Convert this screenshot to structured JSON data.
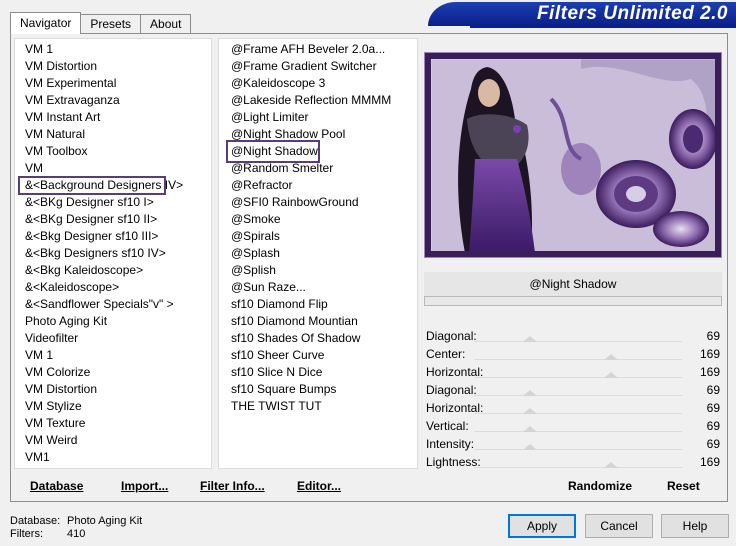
{
  "tabs": [
    {
      "label": "Navigator",
      "active": true
    },
    {
      "label": "Presets",
      "active": false
    },
    {
      "label": "About",
      "active": false
    }
  ],
  "banner_title": "Filters Unlimited 2.0",
  "categories": [
    "VM 1",
    "VM Distortion",
    "VM Experimental",
    "VM Extravaganza",
    "VM Instant Art",
    "VM Natural",
    "VM Toolbox",
    "VM",
    "&<Background Designers IV>",
    "&<BKg Designer sf10 I>",
    "&<BKg Designer sf10 II>",
    "&<Bkg Designer sf10 III>",
    "&<Bkg Designers sf10 IV>",
    "&<Bkg Kaleidoscope>",
    "&<Kaleidoscope>",
    "&<Sandflower Specials\"v\" >",
    "Photo Aging Kit",
    "Videofilter",
    "VM 1",
    "VM Colorize",
    "VM Distortion",
    "VM Stylize",
    "VM Texture",
    "VM Weird",
    "VM1"
  ],
  "selected_category_index": 8,
  "filters": [
    "@Frame AFH Beveler 2.0a...",
    "@Frame Gradient Switcher",
    "@Kaleidoscope 3",
    "@Lakeside Reflection MMMM",
    "@Light Limiter",
    "@Night Shadow Pool",
    "@Night Shadow",
    "@Random Smelter",
    "@Refractor",
    "@SFI0 RainbowGround",
    "@Smoke",
    "@Spirals",
    "@Splash",
    "@Splish",
    "@Sun Raze...",
    "sf10 Diamond Flip",
    "sf10 Diamond Mountian",
    "sf10 Shades Of Shadow",
    "sf10 Sheer Curve",
    "sf10 Slice N Dice",
    "sf10 Square Bumps",
    "THE TWIST TUT"
  ],
  "selected_filter_index": 6,
  "filter_title": "@Night Shadow",
  "params": [
    {
      "label": "Diagonal:",
      "value": "69",
      "level": 0.27
    },
    {
      "label": "Center:",
      "value": "169",
      "level": 0.66
    },
    {
      "label": "Horizontal:",
      "value": "169",
      "level": 0.66
    },
    {
      "label": "Diagonal:",
      "value": "69",
      "level": 0.27
    },
    {
      "label": "Horizontal:",
      "value": "69",
      "level": 0.27
    },
    {
      "label": "Vertical:",
      "value": "69",
      "level": 0.27
    },
    {
      "label": "Intensity:",
      "value": "69",
      "level": 0.27
    },
    {
      "label": "Lightness:",
      "value": "169",
      "level": 0.66
    }
  ],
  "bottom_links": [
    "Database",
    "Import...",
    "Filter Info...",
    "Editor..."
  ],
  "randomize_label": "Randomize",
  "reset_label": "Reset",
  "status": {
    "database_key": "Database:",
    "database_value": "Photo Aging Kit",
    "filters_key": "Filters:",
    "filters_value": "410"
  },
  "buttons": {
    "apply": "Apply",
    "cancel": "Cancel",
    "help": "Help"
  },
  "colors": {
    "banner": "#0a1f8a",
    "selection_border": "#5a3c78",
    "preview_frame": "#3a1e5a"
  }
}
